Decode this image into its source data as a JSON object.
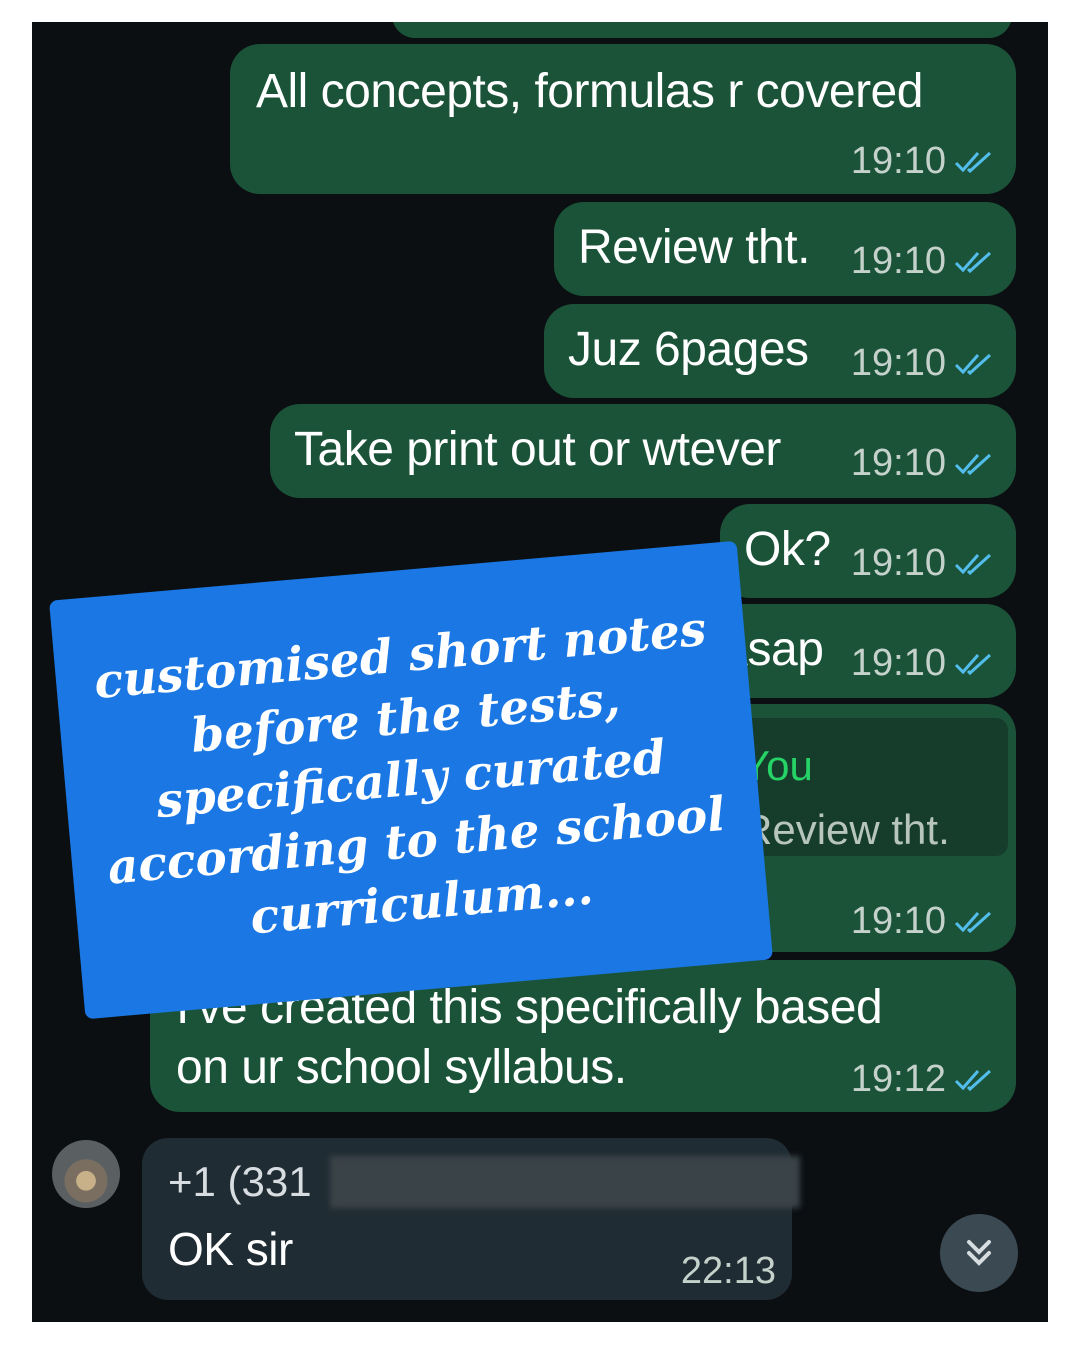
{
  "messages": [
    {
      "text": "All concepts, formulas r covered",
      "time": "19:10"
    },
    {
      "text": "Review tht.",
      "time": "19:10"
    },
    {
      "text": "Juz 6pages",
      "time": "19:10"
    },
    {
      "text": "Take print out or wtever",
      "time": "19:10"
    },
    {
      "text": "Ok?",
      "time": "19:10"
    },
    {
      "text": "Asap",
      "time": "19:10"
    },
    {
      "reply_author": "You",
      "reply_text": "Review tht.",
      "text": ".",
      "time": "19:10"
    },
    {
      "text_line1": "I've created this specifically based",
      "text_line2": "on ur school syllabus.",
      "time": "19:12"
    }
  ],
  "incoming": {
    "sender": "+1 (331",
    "text": "OK sir",
    "time": "22:13"
  },
  "overlay": {
    "text": "customised short notes\nbefore the tests,\nspecifically curated\naccording to the school\ncurriculum..."
  },
  "icons": {
    "read_receipt": "double-check-icon",
    "scroll_down": "chevron-double-down-icon"
  },
  "colors": {
    "chat_background": "#0b0f12",
    "outgoing_bubble": "#1b5339",
    "incoming_bubble": "#202c33",
    "overlay": "#1a77e3",
    "tick": "#53bdeb",
    "reply_author": "#25d366"
  }
}
